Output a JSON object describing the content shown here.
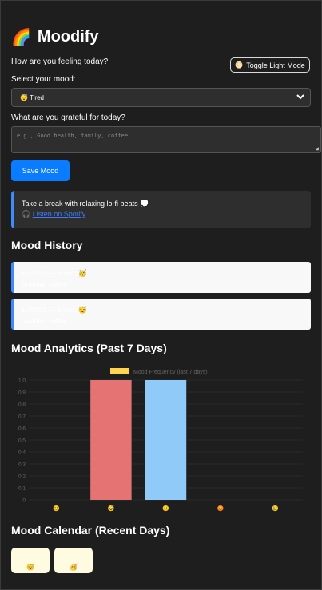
{
  "app": {
    "title": "Moodify",
    "title_icon": "🌈",
    "toggle_label": "Toggle Light Mode",
    "toggle_icon": "🌕"
  },
  "form": {
    "feeling_question": "How are you feeling today?",
    "mood_label": "Select your mood:",
    "mood_selected": "😴 Tired",
    "grateful_label": "What are you grateful for today?",
    "grateful_placeholder": "e.g., Good health, family, coffee...",
    "grateful_value": "",
    "save_label": "Save Mood"
  },
  "music": {
    "text": "Take a break with relaxing lo-fi beats 💭",
    "link_icon": "🎧",
    "link_text": "Listen on Spotify"
  },
  "history": {
    "heading": "Mood History",
    "entries": [
      {
        "line1": "6/7/2025 — Mood: 🥳",
        "line2": "Grateful: coffee"
      },
      {
        "line1": "6/7/2025 — Mood: 😴",
        "line2": "Grateful: coffee"
      }
    ]
  },
  "analytics": {
    "heading": "Mood Analytics (Past 7 Days)"
  },
  "chart_data": {
    "type": "bar",
    "legend": "Mood Frequency (last 7 days)",
    "legend_color": "#ffd54f",
    "categories": [
      "😊",
      "😴",
      "😐",
      "😡",
      "😢"
    ],
    "values": [
      0,
      1,
      1,
      0,
      0
    ],
    "bar_colors": [
      "#f06292",
      "#e57373",
      "#90caf9",
      "#aed581",
      "#ffd54f"
    ],
    "ylim": [
      0,
      1
    ],
    "yticks": [
      "0",
      "0.1",
      "0.2",
      "0.3",
      "0.4",
      "0.5",
      "0.6",
      "0.7",
      "0.8",
      "0.9",
      "1.0"
    ],
    "grid": true
  },
  "calendar": {
    "heading": "Mood Calendar (Recent Days)",
    "days": [
      "😴",
      "🥳"
    ]
  }
}
